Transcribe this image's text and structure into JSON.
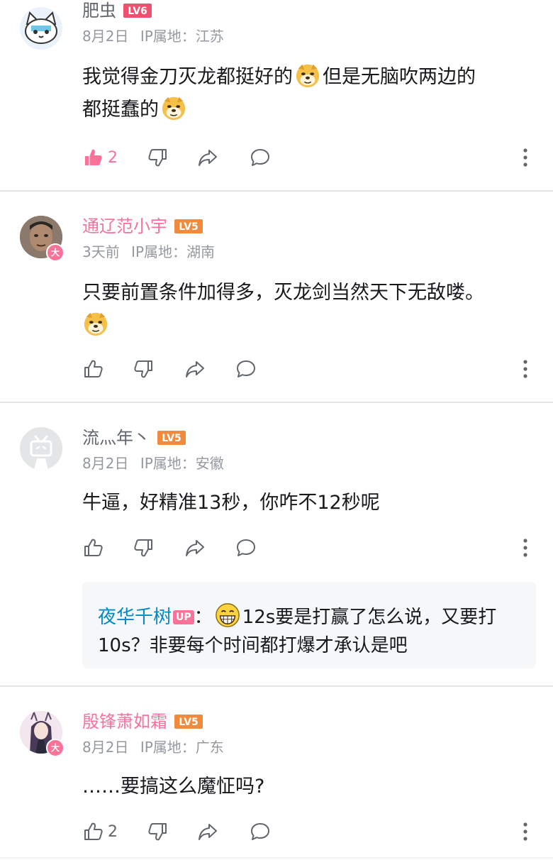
{
  "comments": [
    {
      "username": "肥虫",
      "level": "LV6",
      "date": "8月2日",
      "ip_label": "IP属地：",
      "ip_location": "江苏",
      "text_part1": "我觉得金刀灭龙都挺好的",
      "text_part2": "但是无脑吹两边的",
      "text_part3": "都挺蠢的",
      "like_count": "2",
      "liked": true
    },
    {
      "username": "通辽范小宇",
      "level": "LV5",
      "date": "3天前",
      "ip_label": "IP属地：",
      "ip_location": "湖南",
      "avatar_badge": "大",
      "text_part1": "只要前置条件加得多，灭龙剑当然天下无敌喽。",
      "like_count": ""
    },
    {
      "username": "流灬年丶",
      "level": "LV5",
      "date": "8月2日",
      "ip_label": "IP属地：",
      "ip_location": "安徽",
      "text_part1": "牛逼，好精准13秒，你咋不12秒呢",
      "like_count": "",
      "reply": {
        "name": "夜华千树",
        "tag": "UP",
        "colon": "：",
        "text": "12s要是打赢了怎么说，又要打10s？非要每个时间都打爆才承认是吧"
      }
    },
    {
      "username": "殷锋萧如霜",
      "level": "LV5",
      "date": "8月2日",
      "ip_label": "IP属地：",
      "ip_location": "广东",
      "avatar_badge": "大",
      "text_part1": "……要搞这么魔怔吗?",
      "like_count": "2"
    }
  ],
  "colors": {
    "vip_pink": "#fb7299",
    "level_orange": "#f08a3c",
    "level_red": "#f0506e",
    "reply_name_blue": "#008ac5",
    "meta_gray": "#9499a0"
  },
  "icons": [
    "like-icon",
    "dislike-icon",
    "share-icon",
    "reply-icon",
    "more-icon",
    "doge-emoji",
    "grin-emoji"
  ]
}
